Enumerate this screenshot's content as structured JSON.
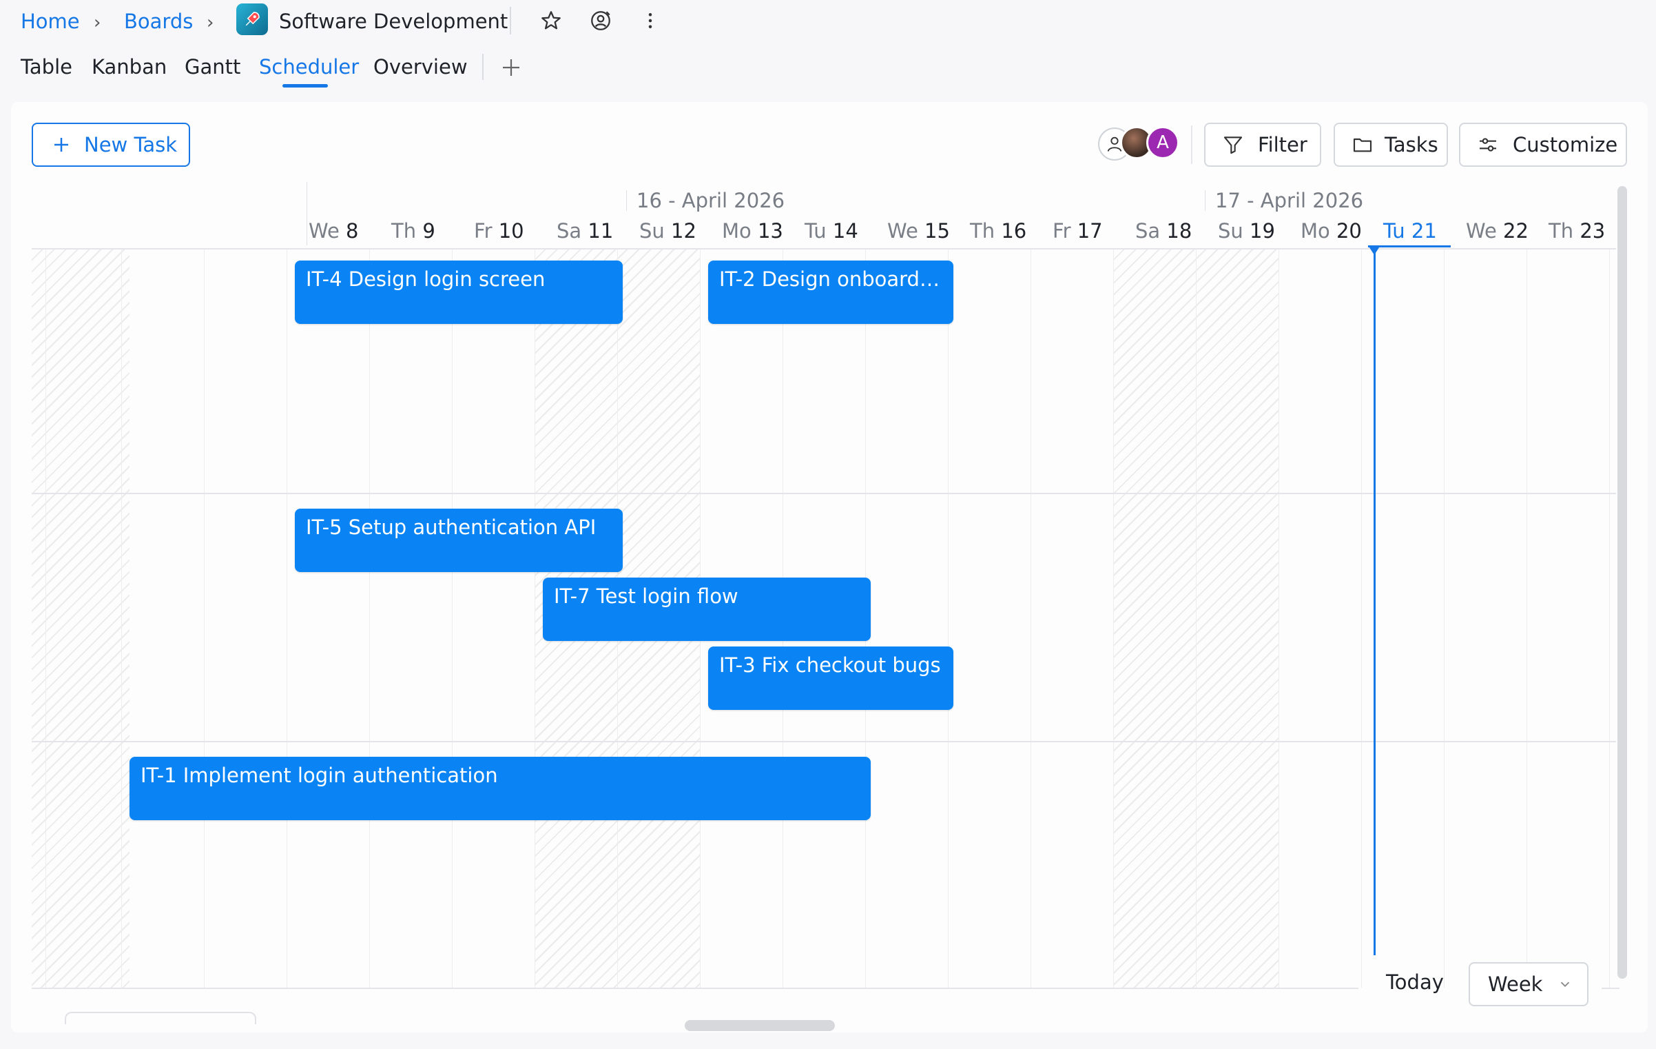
{
  "breadcrumb": {
    "home": "Home",
    "boards": "Boards",
    "project": "Software Development"
  },
  "tabs": [
    "Table",
    "Kanban",
    "Gantt",
    "Scheduler",
    "Overview"
  ],
  "active_tab": "Scheduler",
  "toolbar": {
    "new_task": "New Task",
    "filter": "Filter",
    "tasks": "Tasks",
    "customize": "Customize",
    "avatar_letter": "A"
  },
  "timeline": {
    "week_labels": [
      "16 - April 2026",
      "17 - April 2026"
    ],
    "days": [
      {
        "dow": "We",
        "num": "8"
      },
      {
        "dow": "Th",
        "num": "9"
      },
      {
        "dow": "Fr",
        "num": "10"
      },
      {
        "dow": "Sa",
        "num": "11"
      },
      {
        "dow": "Su",
        "num": "12"
      },
      {
        "dow": "Mo",
        "num": "13"
      },
      {
        "dow": "Tu",
        "num": "14"
      },
      {
        "dow": "We",
        "num": "15"
      },
      {
        "dow": "Th",
        "num": "16"
      },
      {
        "dow": "Fr",
        "num": "17"
      },
      {
        "dow": "Sa",
        "num": "18"
      },
      {
        "dow": "Su",
        "num": "19"
      },
      {
        "dow": "Mo",
        "num": "20"
      },
      {
        "dow": "Tu",
        "num": "21"
      },
      {
        "dow": "We",
        "num": "22"
      },
      {
        "dow": "Th",
        "num": "23"
      }
    ],
    "today_index": 13
  },
  "events": [
    {
      "label": "IT-4 Design login screen",
      "row": 0,
      "lane": 0,
      "start": 0,
      "end": 4
    },
    {
      "label": "IT-2 Design onboardin...",
      "row": 0,
      "lane": 0,
      "start": 5,
      "end": 8
    },
    {
      "label": "IT-5 Setup authentication API",
      "row": 1,
      "lane": 0,
      "start": 0,
      "end": 4
    },
    {
      "label": "IT-7 Test login flow",
      "row": 1,
      "lane": 1,
      "start": 3,
      "end": 7
    },
    {
      "label": "IT-3 Fix checkout bugs",
      "row": 1,
      "lane": 2,
      "start": 5,
      "end": 8
    },
    {
      "label": "IT-1 Implement login authentication",
      "row": 2,
      "lane": 0,
      "start": -2,
      "end": 7
    }
  ],
  "footer": {
    "today": "Today",
    "view": "Week"
  },
  "colors": {
    "accent": "#1677e6",
    "event": "#0a84f5",
    "avatar_a": "#9c27b0"
  },
  "icons": [
    "chevron-right-icon",
    "rocket-icon",
    "star-icon",
    "at-user-icon",
    "more-vertical-icon",
    "plus-icon",
    "user-outline-icon",
    "filter-icon",
    "folder-icon",
    "sliders-icon",
    "chevron-down-icon"
  ]
}
